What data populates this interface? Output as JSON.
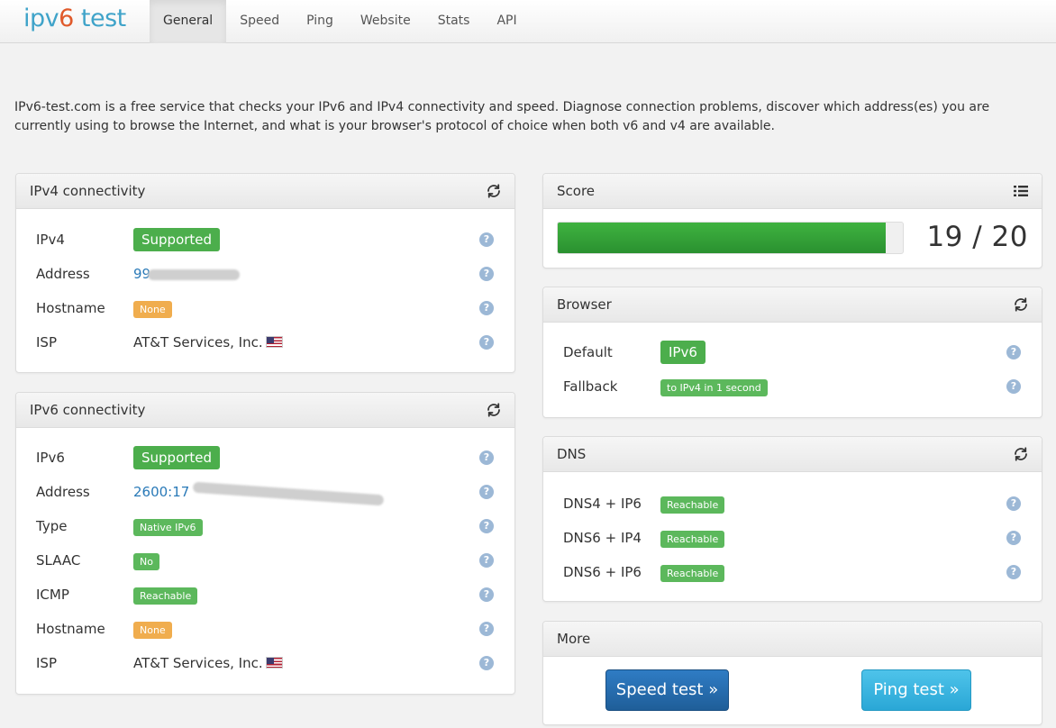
{
  "brand": {
    "part1": "ipv",
    "part2": "6",
    "part3": " test"
  },
  "nav": [
    "General",
    "Speed",
    "Ping",
    "Website",
    "Stats",
    "API"
  ],
  "intro": "IPv6-test.com is a free service that checks your IPv6 and IPv4 connectivity and speed. Diagnose connection problems, discover which address(es) you are currently using to browse the Internet, and what is your browser's protocol of choice when both v6 and v4 are available.",
  "ipv4": {
    "title": "IPv4 connectivity",
    "rows": [
      {
        "label": "IPv4",
        "value": "Supported"
      },
      {
        "label": "Address",
        "value": "99."
      },
      {
        "label": "Hostname",
        "value": "None"
      },
      {
        "label": "ISP",
        "value": "AT&T Services, Inc."
      }
    ]
  },
  "ipv6": {
    "title": "IPv6 connectivity",
    "rows": [
      {
        "label": "IPv6",
        "value": "Supported"
      },
      {
        "label": "Address",
        "value": "2600:17"
      },
      {
        "label": "Type",
        "value": "Native IPv6"
      },
      {
        "label": "SLAAC",
        "value": "No"
      },
      {
        "label": "ICMP",
        "value": "Reachable"
      },
      {
        "label": "Hostname",
        "value": "None"
      },
      {
        "label": "ISP",
        "value": "AT&T Services, Inc."
      }
    ]
  },
  "score": {
    "title": "Score",
    "value": "19 / 20",
    "fraction": 0.95
  },
  "browser": {
    "title": "Browser",
    "rows": [
      {
        "label": "Default",
        "value": "IPv6"
      },
      {
        "label": "Fallback",
        "value": "to IPv4 in 1 second"
      }
    ]
  },
  "dns": {
    "title": "DNS",
    "rows": [
      {
        "label": "DNS4 + IP6",
        "value": "Reachable"
      },
      {
        "label": "DNS6 + IP4",
        "value": "Reachable"
      },
      {
        "label": "DNS6 + IP6",
        "value": "Reachable"
      }
    ]
  },
  "more": {
    "title": "More",
    "speed_button": "Speed test »",
    "ping_button": "Ping test »"
  },
  "help_glyph": "?",
  "colors": {
    "success": "#4cae4c",
    "warning": "#f0ad4e",
    "link": "#2a7ab8",
    "primary": "#2f7cc4",
    "info": "#3bb8e3"
  },
  "icons": {
    "refresh": "refresh-icon",
    "list": "list-icon",
    "help": "help-icon",
    "flag": "us-flag-icon"
  }
}
